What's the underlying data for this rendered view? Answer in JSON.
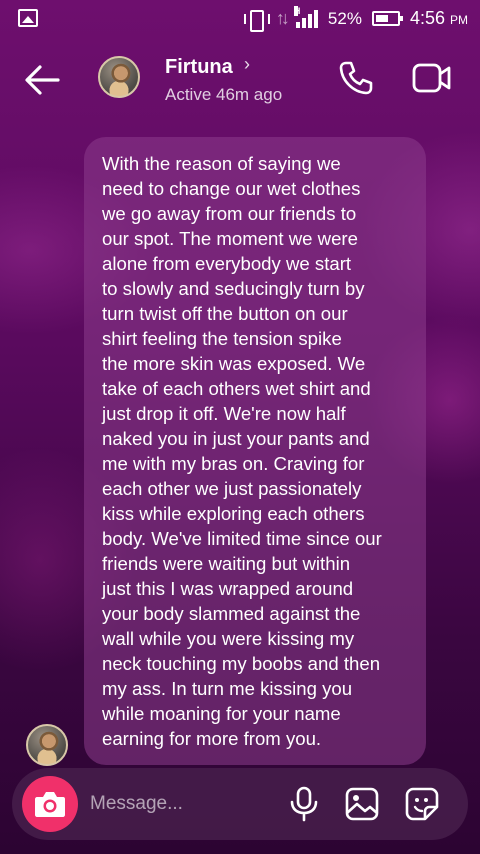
{
  "status_bar": {
    "battery": "52%",
    "time": "4:56",
    "time_suffix": "PM",
    "icons": [
      "image-icon",
      "vibrate-icon",
      "data-arrows-icon",
      "signal-icon",
      "battery-icon"
    ]
  },
  "header": {
    "contact_name": "Firtuna",
    "contact_status": "Active 46m ago",
    "chevron": "›",
    "icons": [
      "back-arrow-icon",
      "phone-icon",
      "video-camera-icon"
    ]
  },
  "message": {
    "text": "With the reason of saying we\nneed to change our wet clothes\nwe go away from our friends to\nour spot. The moment we were\nalone from everybody we start\nto slowly and seducingly turn by\nturn twist off the button on our\nshirt feeling the tension spike\nthe more skin was exposed. We\ntake of each others wet shirt and\njust drop it off. We're now half\nnaked you in just your pants and\nme with my bras on. Craving for\neach other we just passionately\nkiss while exploring each others\nbody. We've limited time since our\nfriends were waiting but within\njust this I was wrapped around\nyour body slammed against the\nwall while you were kissing my\nneck touching my boobs and then\nmy ass. In turn me kissing you\nwhile moaning for your name\nearning for more from you."
  },
  "composer": {
    "placeholder": "Message...",
    "icons": [
      "camera-icon",
      "microphone-icon",
      "gallery-icon",
      "sticker-icon"
    ]
  },
  "colors": {
    "background_top": "#6e0f6e",
    "background_bottom": "#2c0432",
    "bubble": "#8c3c8c",
    "camera_button": "#f0306a"
  }
}
